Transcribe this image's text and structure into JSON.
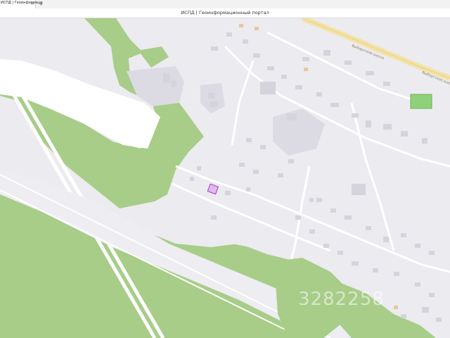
{
  "browser": {
    "tab_title": "ИСПД | Геоинформаци",
    "tab_close": "×",
    "new_tab": "+",
    "page_title": "ИСПД | Геоинформационный портал"
  },
  "map": {
    "road_labels": [
      "Выборгское шоссе",
      "Выборгское шоссе"
    ],
    "watermark": "3282258",
    "colors": {
      "background": "#ecebf0",
      "forest": "#a7cd88",
      "building": "#d8d6de",
      "road": "#ffffff",
      "highway": "#f3e3a8",
      "selected_parcel": "#e3b8f0",
      "selected_parcel_border": "#a040c0",
      "sports_field": "#8fd07a"
    }
  }
}
